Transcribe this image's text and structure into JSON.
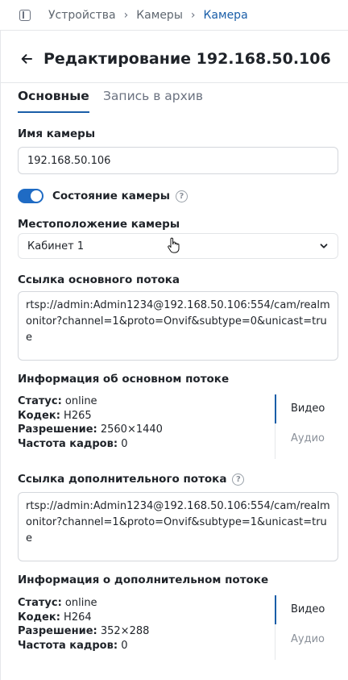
{
  "breadcrumbs": {
    "items": [
      "Устройства",
      "Камеры",
      "Камера"
    ]
  },
  "header": {
    "title": "Редактирование 192.168.50.106"
  },
  "tabs": [
    {
      "label": "Основные",
      "active": true
    },
    {
      "label": "Запись в архив",
      "active": false
    }
  ],
  "form": {
    "camera_name": {
      "label": "Имя камеры",
      "value": "192.168.50.106"
    },
    "camera_state": {
      "label": "Состояние камеры",
      "enabled": true
    },
    "location": {
      "label": "Местоположение камеры",
      "value": "Кабинет 1"
    },
    "main_stream": {
      "label": "Ссылка основного потока",
      "value": "rtsp://admin:Admin1234@192.168.50.106:554/cam/realmonitor?channel=1&proto=Onvif&subtype=0&unicast=true"
    },
    "main_info": {
      "label": "Информация об основном потоке",
      "status_key": "Статус:",
      "status_value": "online",
      "codec_key": "Кодек:",
      "codec_value": "H265",
      "resolution_key": "Разрешение:",
      "resolution_value": "2560×1440",
      "fps_key": "Частота кадров:",
      "fps_value": "0",
      "tab_video": "Видео",
      "tab_audio": "Аудио"
    },
    "sub_stream": {
      "label": "Ссылка дополнительного потока",
      "value": "rtsp://admin:Admin1234@192.168.50.106:554/cam/realmonitor?channel=1&proto=Onvif&subtype=1&unicast=true"
    },
    "sub_info": {
      "label": "Информация о дополнительном потоке",
      "status_key": "Статус:",
      "status_value": "online",
      "codec_key": "Кодек:",
      "codec_value": "H264",
      "resolution_key": "Разрешение:",
      "resolution_value": "352×288",
      "fps_key": "Частота кадров:",
      "fps_value": "0",
      "tab_video": "Видео",
      "tab_audio": "Аудио"
    }
  },
  "help_glyph": "?",
  "colors": {
    "accent": "#1a5ea8",
    "toggle_on": "#1f6bc4",
    "border": "#d4d7dc",
    "muted_text": "#6b7280"
  },
  "icons": [
    "sidebar-toggle-icon",
    "chevron-right-icon",
    "back-arrow-icon",
    "help-icon",
    "chevron-down-icon",
    "hand-cursor-icon"
  ]
}
